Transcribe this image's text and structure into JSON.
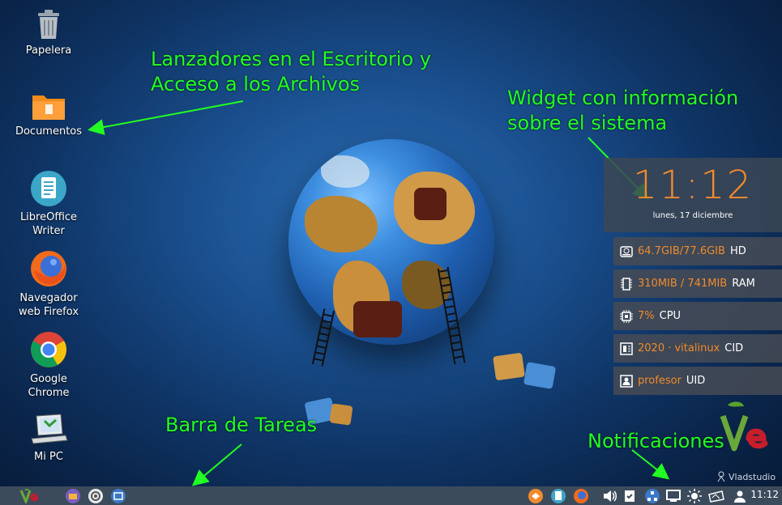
{
  "desktop": {
    "icons": [
      {
        "label": "Papelera"
      },
      {
        "label": "Documentos"
      },
      {
        "label": "LibreOffice\nWriter"
      },
      {
        "label": "Navegador\nweb Firefox"
      },
      {
        "label": "Google\nChrome"
      },
      {
        "label": "Mi PC"
      }
    ]
  },
  "annotations": {
    "launchers": "Lanzadores en el Escritorio y\nAcceso a los Archivos",
    "widget": "Widget con información\nsobre el sistema",
    "taskbar": "Barra de Tareas",
    "notifications": "Notificaciones",
    "color": "#22ff22"
  },
  "widget": {
    "time": "11:12",
    "date": "lunes, 17 diciembre",
    "accent": "#f28b2c",
    "rows": [
      {
        "icon": "hard-disk-icon",
        "value": "64.7GIB/77.6GIB",
        "label": "HD"
      },
      {
        "icon": "memory-icon",
        "value": "310MIB / 741MIB",
        "label": "RAM"
      },
      {
        "icon": "cpu-icon",
        "value": "7%",
        "label": "CPU"
      },
      {
        "icon": "id-card-icon",
        "value": "2020 · vitalinux",
        "label": "CID"
      },
      {
        "icon": "user-icon",
        "value": "profesor",
        "label": "UID"
      }
    ]
  },
  "watermark": {
    "text": "Vladstudio"
  },
  "taskbar": {
    "clock": "11:12",
    "background": "#3c4b5c"
  }
}
